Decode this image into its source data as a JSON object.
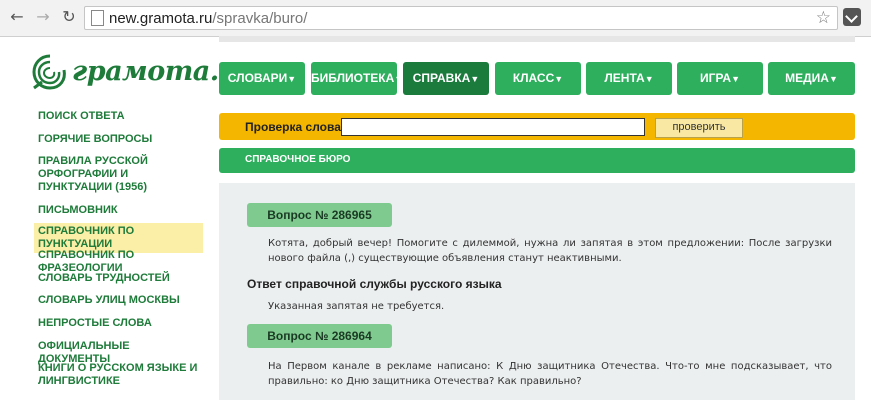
{
  "browser": {
    "url_host": "new.gramota.ru",
    "url_path": "/spravka/buro/"
  },
  "logo": {
    "text": "грамота.ру"
  },
  "menu": [
    {
      "label": "СЛОВАРИ",
      "active": false
    },
    {
      "label": "БИБЛИОТЕКА",
      "active": false
    },
    {
      "label": "СПРАВКА",
      "active": true
    },
    {
      "label": "КЛАСС",
      "active": false
    },
    {
      "label": "ЛЕНТА",
      "active": false
    },
    {
      "label": "ИГРА",
      "active": false
    },
    {
      "label": "МЕДИА",
      "active": false
    }
  ],
  "sidebar": [
    {
      "label": "ПОИСК ОТВЕТА"
    },
    {
      "label": "ГОРЯЧИЕ ВОПРОСЫ"
    },
    {
      "label": "ПРАВИЛА РУССКОЙ ОРФОГРАФИИ И ПУНКТУАЦИИ (1956)"
    },
    {
      "label": "ПИСЬМОВНИК"
    },
    {
      "label": "СПРАВОЧНИК ПО ПУНКТУАЦИИ",
      "active": true
    },
    {
      "label": "СПРАВОЧНИК ПО ФРАЗЕОЛОГИИ"
    },
    {
      "label": "СЛОВАРЬ ТРУДНОСТЕЙ"
    },
    {
      "label": "СЛОВАРЬ УЛИЦ МОСКВЫ"
    },
    {
      "label": "НЕПРОСТЫЕ СЛОВА"
    },
    {
      "label": "ОФИЦИАЛЬНЫЕ ДОКУМЕНТЫ"
    },
    {
      "label": "КНИГИ О РУССКОМ ЯЗЫКЕ И ЛИНГВИСТИКЕ"
    }
  ],
  "check": {
    "label": "Проверка слова:",
    "value": "",
    "button": "проверить"
  },
  "section": {
    "title": "СПРАВОЧНОЕ БЮРО"
  },
  "questions": [
    {
      "badge": "Вопрос № 286965",
      "text": "Котята, добрый вечер! Помогите с дилеммой, нужна ли запятая в этом предложении: После загрузки нового файла (,) существующие объявления станут неактивными.",
      "answer_heading": "Ответ справочной службы русского языка",
      "answer": "Указанная запятая не требуется."
    },
    {
      "badge": "Вопрос № 286964",
      "text": "На Первом канале в рекламе написано: К Дню защитника Отечества. Что-то мне подсказывает, что правильно: ко Дню защитника Отечества? Как правильно?"
    }
  ],
  "colors": {
    "green": "#2eaf5e",
    "green_active": "#1a7b3d",
    "yellow": "#f5b600",
    "badge_green": "#7fcb8f",
    "highlight": "#fbeea6"
  }
}
